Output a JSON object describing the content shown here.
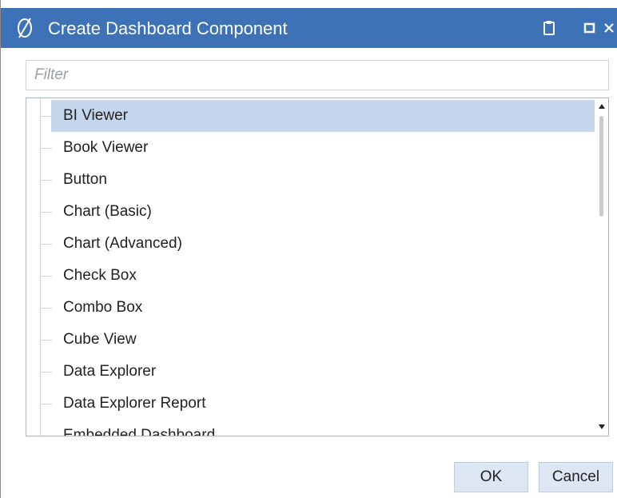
{
  "window": {
    "title": "Create Dashboard Component",
    "logo_icon": "onestream-logo-icon",
    "controls": [
      "clipboard-icon",
      "maximize-icon",
      "close-icon"
    ],
    "accent_color": "#3d72b6"
  },
  "filter": {
    "placeholder": "Filter",
    "value": ""
  },
  "components": {
    "selected": "BI Viewer",
    "items": [
      {
        "label": "BI Viewer"
      },
      {
        "label": "Book Viewer"
      },
      {
        "label": "Button"
      },
      {
        "label": "Chart (Basic)"
      },
      {
        "label": "Chart (Advanced)"
      },
      {
        "label": "Check Box"
      },
      {
        "label": "Combo Box"
      },
      {
        "label": "Cube View"
      },
      {
        "label": "Data Explorer"
      },
      {
        "label": "Data Explorer Report"
      },
      {
        "label": "Embedded Dashboard"
      }
    ]
  },
  "buttons": {
    "ok": "OK",
    "cancel": "Cancel"
  }
}
